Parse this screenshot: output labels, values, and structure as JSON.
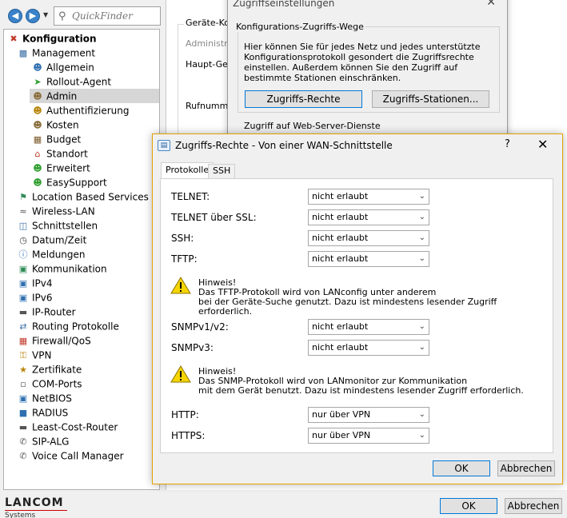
{
  "toolbar": {
    "quickfinder_placeholder": "QuickFinder"
  },
  "tree": {
    "items": [
      {
        "label": "Konfiguration",
        "icon": "wrench-icon"
      },
      {
        "label": "Management",
        "icon": "computer-icon"
      },
      {
        "label": "Allgemein",
        "icon": "users-icon"
      },
      {
        "label": "Rollout-Agent",
        "icon": "arrow-right-icon"
      },
      {
        "label": "Admin",
        "icon": "user-icon"
      },
      {
        "label": "Authentifizierung",
        "icon": "user-key-icon"
      },
      {
        "label": "Kosten",
        "icon": "user-icon"
      },
      {
        "label": "Budget",
        "icon": "budget-icon"
      },
      {
        "label": "Standort",
        "icon": "house-icon"
      },
      {
        "label": "Erweitert",
        "icon": "user-plus-icon"
      },
      {
        "label": "EasySupport",
        "icon": "user-plus-icon"
      },
      {
        "label": "Location Based Services",
        "icon": "flag-icon"
      },
      {
        "label": "Wireless-LAN",
        "icon": "wireless-icon"
      },
      {
        "label": "Schnittstellen",
        "icon": "interfaces-icon"
      },
      {
        "label": "Datum/Zeit",
        "icon": "clock-icon"
      },
      {
        "label": "Meldungen",
        "icon": "info-icon"
      },
      {
        "label": "Kommunikation",
        "icon": "network-icon"
      },
      {
        "label": "IPv4",
        "icon": "ip-icon"
      },
      {
        "label": "IPv6",
        "icon": "ip-icon"
      },
      {
        "label": "IP-Router",
        "icon": "router-icon"
      },
      {
        "label": "Routing Protokolle",
        "icon": "routing-icon"
      },
      {
        "label": "Firewall/QoS",
        "icon": "firewall-icon"
      },
      {
        "label": "VPN",
        "icon": "lock-icon"
      },
      {
        "label": "Zertifikate",
        "icon": "certificate-icon"
      },
      {
        "label": "COM-Ports",
        "icon": "port-icon"
      },
      {
        "label": "NetBIOS",
        "icon": "netbios-icon"
      },
      {
        "label": "RADIUS",
        "icon": "radius-icon"
      },
      {
        "label": "Least-Cost-Router",
        "icon": "router-icon"
      },
      {
        "label": "SIP-ALG",
        "icon": "phone-icon"
      },
      {
        "label": "Voice Call Manager",
        "icon": "phone-handset-icon"
      }
    ]
  },
  "main": {
    "group_title": "Geräte-Kon",
    "admin_label": "Administrat",
    "haupt_label": "Haupt-Gerä",
    "ruf_label": "Rufnummer"
  },
  "back_dialog": {
    "title": "Zugriffseinstellungen",
    "group_title": "Konfigurations-Zugriffs-Wege",
    "description": "Hier können Sie für jedes Netz und jedes unterstützte Konfigurationsprotokoll gesondert die Zugriffsrechte einstellen. Außerdem können Sie den Zugriff auf bestimmte Stationen einschränken.",
    "btn_rechte": "Zugriffs-Rechte",
    "btn_stationen": "Zugriffs-Stationen...",
    "group2_title": "Zugriff auf Web-Server-Dienste"
  },
  "dialog": {
    "title": "Zugriffs-Rechte - Von einer WAN-Schnittstelle",
    "help": "?",
    "tabs": [
      "Protokolle",
      "SSH"
    ],
    "protocols": [
      {
        "label": "TELNET:",
        "value": "nicht erlaubt"
      },
      {
        "label": "TELNET über SSL:",
        "value": "nicht erlaubt"
      },
      {
        "label": "SSH:",
        "value": "nicht erlaubt"
      },
      {
        "label": "TFTP:",
        "value": "nicht erlaubt"
      },
      {
        "label": "SNMPv1/v2:",
        "value": "nicht erlaubt"
      },
      {
        "label": "SNMPv3:",
        "value": "nicht erlaubt"
      },
      {
        "label": "HTTP:",
        "value": "nur über VPN"
      },
      {
        "label": "HTTPS:",
        "value": "nur über VPN"
      }
    ],
    "hint1": {
      "title": "Hinweis!",
      "line1": "Das TFTP-Protokoll wird von LANconfig unter anderem",
      "line2": "bei der Geräte-Suche genutzt. Dazu ist mindestens lesender Zugriff erforderlich."
    },
    "hint2": {
      "title": "Hinweis!",
      "line1": "Das SNMP-Protokoll wird von LANmonitor zur Kommunikation",
      "line2": "mit dem Gerät benutzt. Dazu ist mindestens lesender Zugriff erforderlich."
    },
    "ok": "OK",
    "cancel": "Abbrechen"
  },
  "footer": {
    "logo_main": "LANCOM",
    "logo_sub": "Systems",
    "ok": "OK",
    "cancel": "Abbrechen"
  }
}
